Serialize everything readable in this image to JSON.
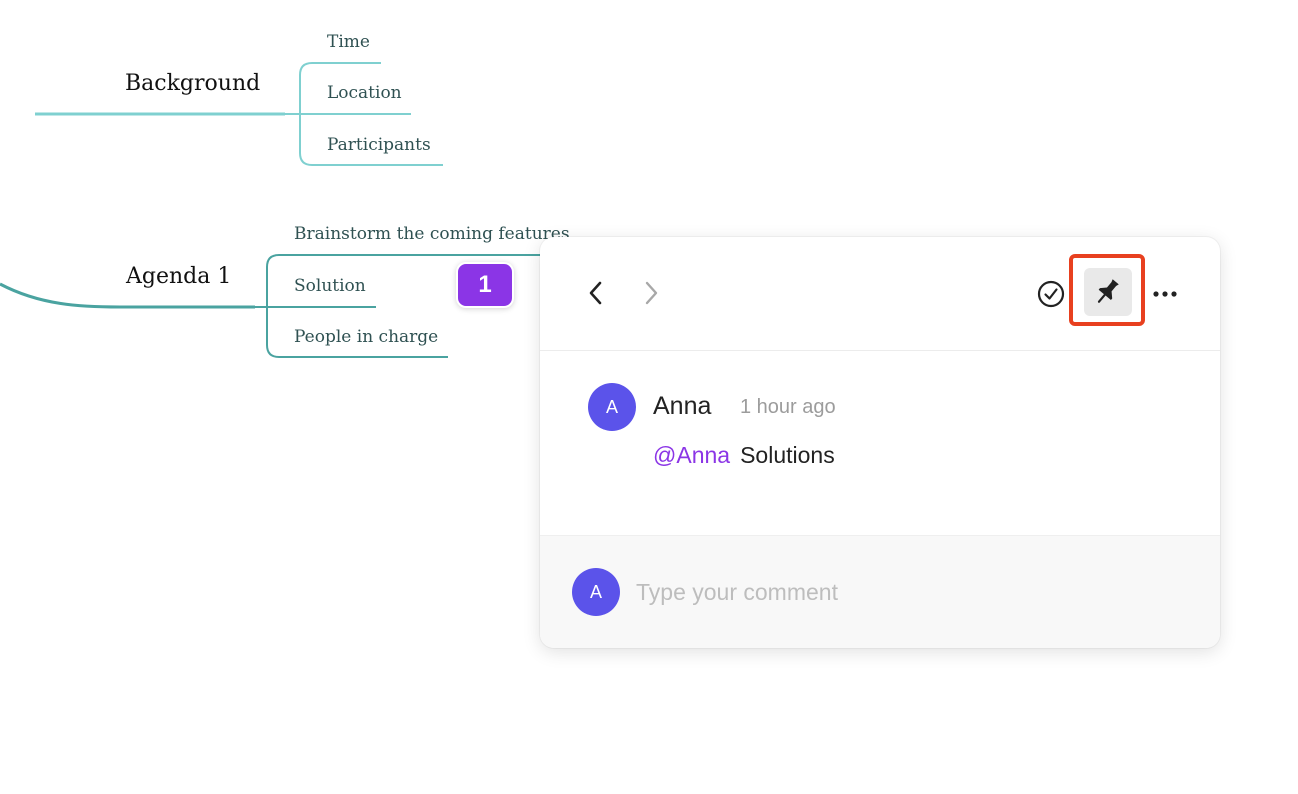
{
  "mindmap": {
    "topics": [
      {
        "label": "Background",
        "color": "#7fd0d0",
        "children": [
          "Time",
          "Location",
          "Participants"
        ]
      },
      {
        "label": "Agenda 1",
        "color": "#4aa3a0",
        "children": [
          "Brainstorm the coming features",
          "Solution",
          "People in charge"
        ]
      }
    ],
    "comment_count": "1"
  },
  "comment_panel": {
    "nav": {
      "prev_icon": "chevron-left-icon",
      "next_icon": "chevron-right-icon"
    },
    "actions": {
      "resolve_icon": "check-circle-icon",
      "pin_icon": "pin-icon",
      "more_icon": "more-horizontal-icon"
    },
    "highlight_color": "#e8401f",
    "comments": [
      {
        "avatar_initial": "A",
        "author": "Anna",
        "time": "1 hour ago",
        "mention": "@Anna",
        "text": "Solutions"
      }
    ],
    "composer": {
      "avatar_initial": "A",
      "placeholder": "Type your comment",
      "value": ""
    }
  },
  "colors": {
    "accent_purple": "#8b35e6",
    "avatar": "#5b53ea"
  }
}
